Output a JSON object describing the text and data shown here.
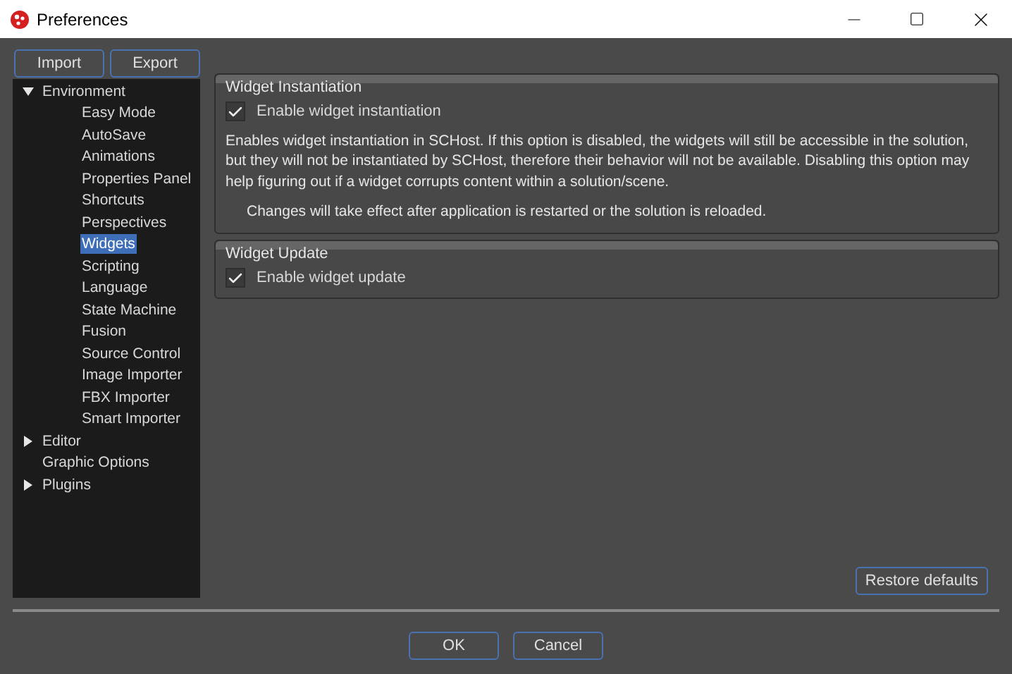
{
  "window": {
    "title": "Preferences"
  },
  "top_buttons": [
    "Import",
    "Export"
  ],
  "tree": [
    {
      "label": "Environment",
      "expanded": true,
      "selected": false,
      "children": [
        {
          "label": "Easy Mode",
          "selected": false
        },
        {
          "label": "AutoSave",
          "selected": false
        },
        {
          "label": "Animations",
          "selected": false
        },
        {
          "label": "Properties Panel",
          "selected": false
        },
        {
          "label": "Shortcuts",
          "selected": false
        },
        {
          "label": "Perspectives",
          "selected": false
        },
        {
          "label": "Widgets",
          "selected": true
        },
        {
          "label": "Scripting",
          "selected": false
        },
        {
          "label": "Language",
          "selected": false
        },
        {
          "label": "State Machine",
          "selected": false
        },
        {
          "label": "Fusion",
          "selected": false
        },
        {
          "label": "Source Control",
          "selected": false
        },
        {
          "label": "Image Importer",
          "selected": false
        },
        {
          "label": "FBX Importer",
          "selected": false
        },
        {
          "label": "Smart Importer",
          "selected": false
        }
      ]
    },
    {
      "label": "Editor",
      "expanded": false,
      "selected": false
    },
    {
      "label": "Graphic Options",
      "selected": false
    },
    {
      "label": "Plugins",
      "expanded": false,
      "selected": false
    }
  ],
  "groups": [
    {
      "title": "Widget Instantiation",
      "checkbox": {
        "label": "Enable widget instantiation",
        "checked": true
      },
      "description": "Enables widget instantiation in SCHost. If this option is disabled, the widgets will still be accessible in the solution, but they will not be instantiated by SCHost, therefore their behavior will not be available. Disabling this option may help figuring out if a widget corrupts content within a solution/scene.",
      "note": "Changes will take effect after application is restarted or the solution is reloaded."
    },
    {
      "title": "Widget Update",
      "checkbox": {
        "label": "Enable widget update",
        "checked": true
      }
    }
  ],
  "restore_button": "Restore defaults",
  "dialog_buttons": [
    "OK",
    "Cancel"
  ]
}
